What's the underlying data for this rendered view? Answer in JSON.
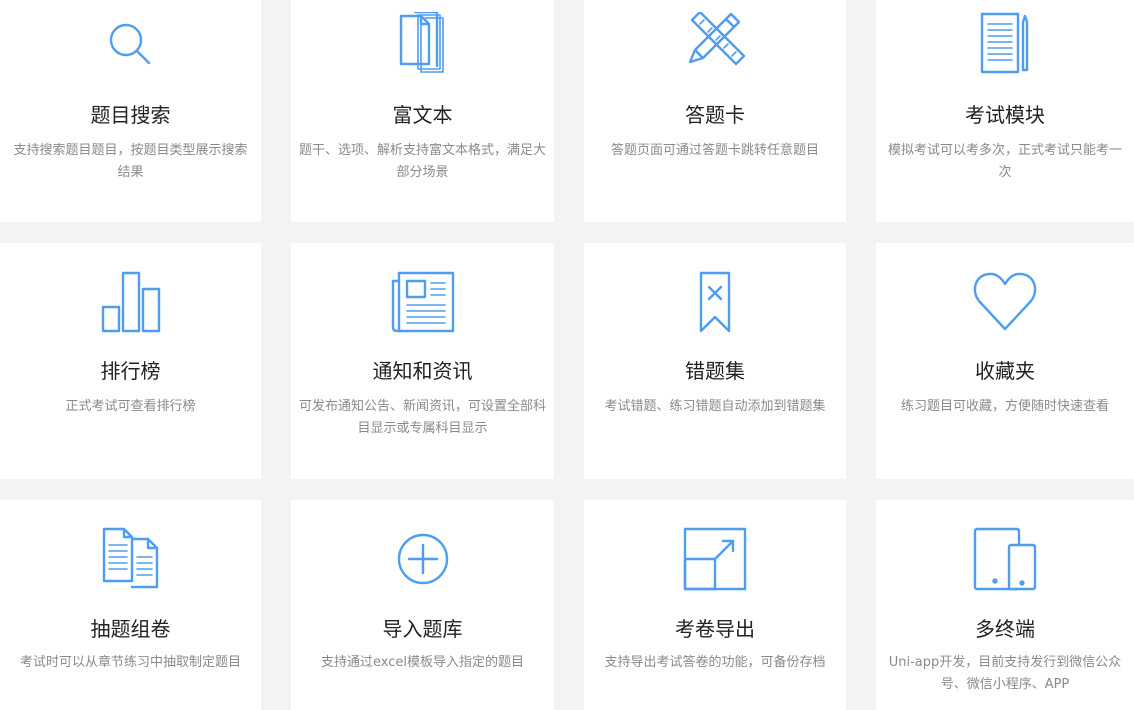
{
  "accent_color": "#4e9df0",
  "features": [
    {
      "icon": "search-icon",
      "title": "题目搜索",
      "desc": "支持搜索题目题目，按题目类型展示搜索结果"
    },
    {
      "icon": "documents-icon",
      "title": "富文本",
      "desc": "题干、选项、解析支持富文本格式，满足大部分场景"
    },
    {
      "icon": "pencil-ruler-icon",
      "title": "答题卡",
      "desc": "答题页面可通过答题卡跳转任意题目"
    },
    {
      "icon": "notepad-pen-icon",
      "title": "考试模块",
      "desc": "模拟考试可以考多次，正式考试只能考一次"
    },
    {
      "icon": "bar-chart-icon",
      "title": "排行榜",
      "desc": "正式考试可查看排行榜"
    },
    {
      "icon": "newspaper-icon",
      "title": "通知和资讯",
      "desc": "可发布通知公告、新闻资讯，可设置全部科目显示或专属科目显示"
    },
    {
      "icon": "bookmark-x-icon",
      "title": "错题集",
      "desc": "考试错题、练习错题自动添加到错题集"
    },
    {
      "icon": "heart-icon",
      "title": "收藏夹",
      "desc": "练习题目可收藏，方便随时快速查看"
    },
    {
      "icon": "copy-documents-icon",
      "title": "抽题组卷",
      "desc": "考试时可以从章节练习中抽取制定题目"
    },
    {
      "icon": "plus-circle-icon",
      "title": "导入题库",
      "desc": "支持通过excel模板导入指定的题目"
    },
    {
      "icon": "export-icon",
      "title": "考卷导出",
      "desc": "支持导出考试答卷的功能，可备份存档"
    },
    {
      "icon": "devices-icon",
      "title": "多终端",
      "desc": "Uni-app开发，目前支持发行到微信公众号、微信小程序、APP"
    }
  ]
}
